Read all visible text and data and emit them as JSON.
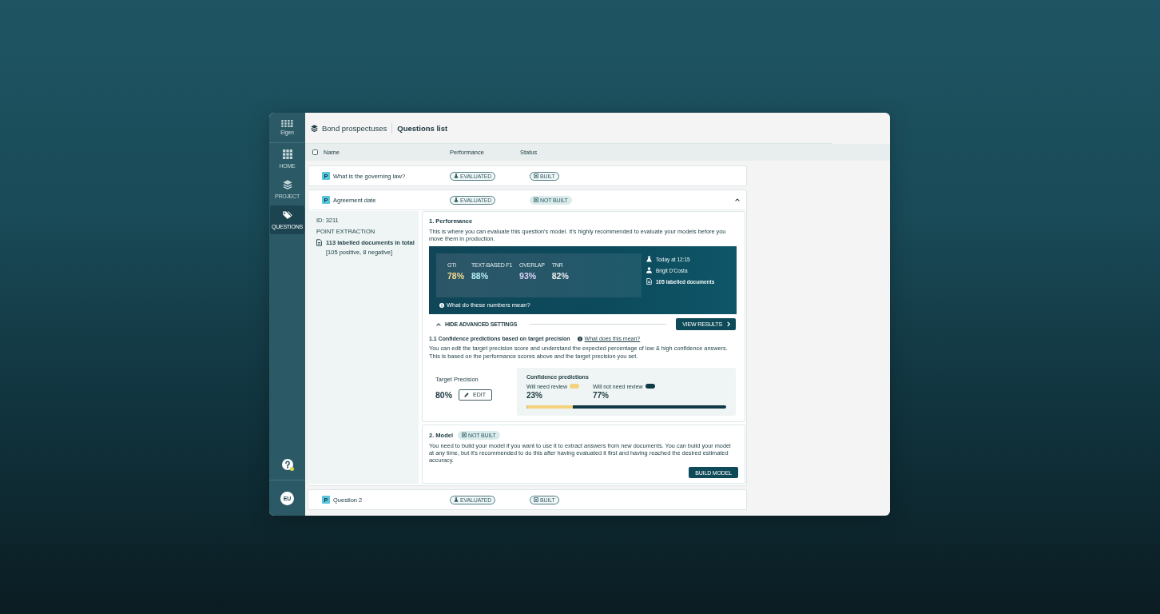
{
  "sidebar": {
    "brand": "Eigen",
    "items": [
      {
        "kind": "home",
        "label": "HOME",
        "selected": false
      },
      {
        "kind": "project",
        "label": "PROJECT",
        "selected": false
      },
      {
        "kind": "questions",
        "label": "QUESTIONS",
        "selected": true
      }
    ],
    "help": {
      "notification": true
    },
    "avatar": "EU"
  },
  "header": {
    "project": "Bond prospectuses",
    "title": "Questions list"
  },
  "table": {
    "select_all": {
      "checked": false
    },
    "columns": [
      "Name",
      "Performance",
      "Status"
    ],
    "rows": [
      {
        "type_label": "P",
        "name": "What is the governing law?",
        "performance": "EVALUATED",
        "status": "BUILT",
        "built": true,
        "expanded": false
      },
      {
        "type_label": "P",
        "name": "Agreement date",
        "performance": "EVALUATED",
        "status": "NOT BUILT",
        "built": false,
        "expanded": true,
        "detail": {
          "id": "ID: 3211",
          "extraction": "POINT EXTRACTION",
          "documents": "113 labelled documents in total",
          "breakdown": "[105 positive, 8 negative]",
          "performance": {
            "title": "1. Performance",
            "description": "This is where you can evaluate this question's model. It's highly recommended to evaluate your models before you move them in production.",
            "metrics": [
              {
                "label": "GTI",
                "value": "78%",
                "color": "#f2da8c"
              },
              {
                "label": "TEXT-BASED F1",
                "value": "88%",
                "color": "#b4eff1"
              },
              {
                "label": "OVERLAP",
                "value": "93%",
                "color": "#dcd3f7"
              },
              {
                "label": "TNR",
                "value": "82%",
                "color": "#ececec"
              }
            ],
            "run": {
              "time": "Today at 12:15",
              "user": "Brigit D'Costa",
              "documents": "105 labelled documents"
            },
            "help_link": "What do these numbers mean?",
            "advanced": {
              "label": "HIDE ADVANCED SETTINGS",
              "expanded": true
            },
            "view_results": "VIEW RESULTS",
            "confidence": {
              "title": "1.1 Confidence predictions based on target precision",
              "help_link": "What does this mean?",
              "description": "You can edit the target precision score and understand the expected percentage of low & high confidence answers. This is based on the performance scores above and the target precision you set.",
              "target_label": "Target Precision",
              "target_value": "80%",
              "edit": "EDIT",
              "predictions_title": "Confidence predictions",
              "groups": [
                {
                  "label": "Will need review",
                  "value": "23%",
                  "color": "#f5d27c"
                },
                {
                  "label": "Will not need review",
                  "value": "77%",
                  "color": "#0f3a45"
                }
              ],
              "level": 0.23
            }
          },
          "model": {
            "title": "2. Model",
            "status": "NOT BUILT",
            "built": false,
            "description": "You need to build your model if you want to use it to extract answers from new documents. You can build your model at any time, but it's recommended to do this after having evaluated it first and having reached the desired estimated accuracy.",
            "button": "BUILD MODEL"
          }
        }
      },
      {
        "type_label": "P",
        "name": "Question 2",
        "performance": "EVALUATED",
        "status": "BUILT",
        "built": true,
        "expanded": false
      }
    ]
  }
}
